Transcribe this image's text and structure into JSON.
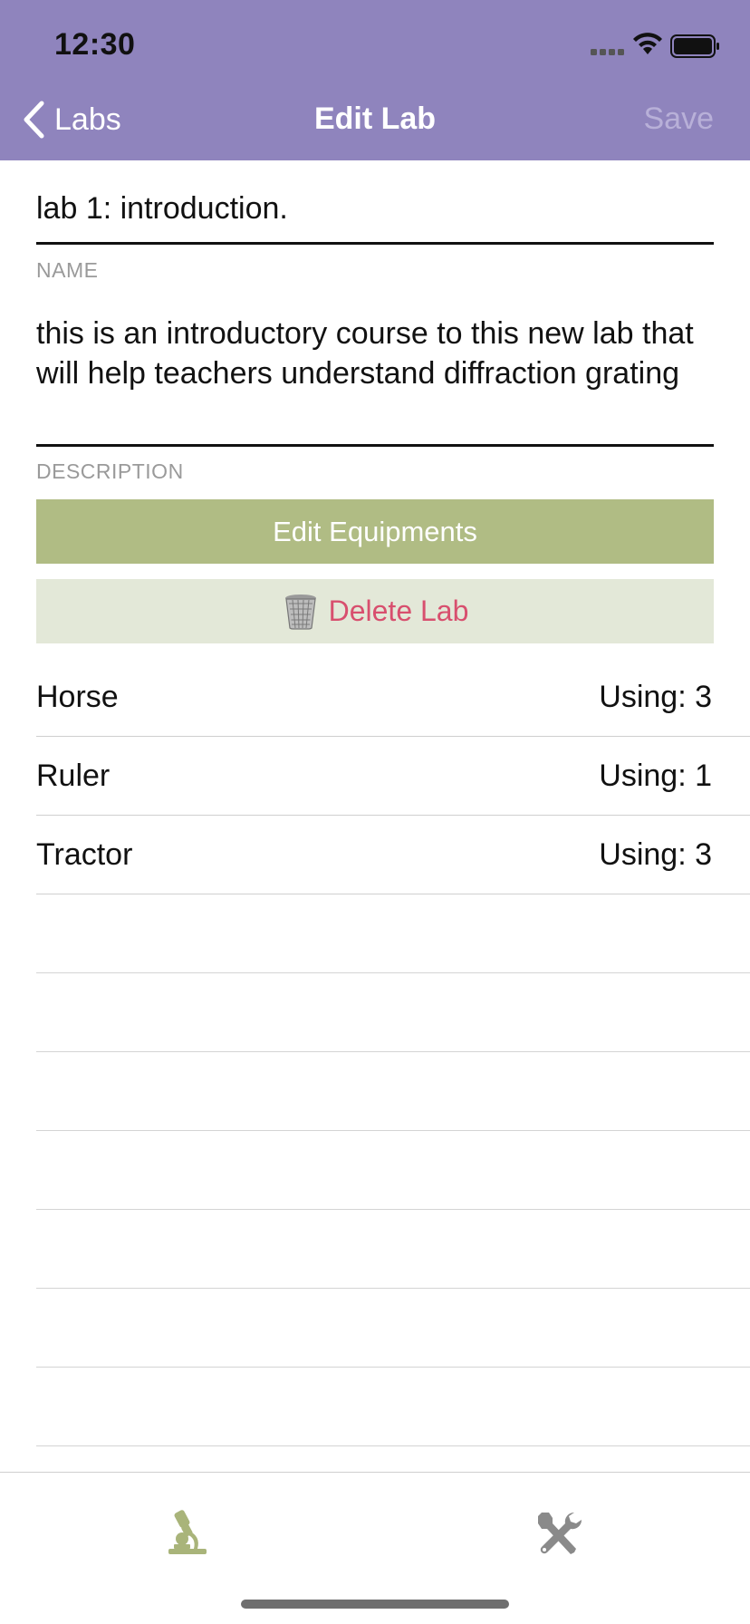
{
  "status_bar": {
    "time": "12:30"
  },
  "nav": {
    "back_label": "Labs",
    "title": "Edit Lab",
    "save_label": "Save"
  },
  "form": {
    "name_value": "lab 1: introduction.",
    "name_label": "NAME",
    "description_value": "this is an introductory course to this new lab that will help teachers understand diffraction grating",
    "description_label": "DESCRIPTION"
  },
  "buttons": {
    "edit_equipments": "Edit Equipments",
    "delete_lab": "Delete Lab"
  },
  "equipment": [
    {
      "name": "Horse",
      "count": "Using: 3"
    },
    {
      "name": "Ruler",
      "count": "Using: 1"
    },
    {
      "name": "Tractor",
      "count": "Using: 3"
    }
  ],
  "tabs": [
    {
      "id": "labs",
      "icon": "microscope-icon",
      "active": true
    },
    {
      "id": "tools",
      "icon": "tools-icon",
      "active": false
    }
  ],
  "colors": {
    "header": "#8F84BD",
    "edit_button": "#B0BC84",
    "delete_button_bg": "#E3E8D8",
    "delete_text": "#D84F6E",
    "active_tab": "#A9B47A",
    "inactive_tab": "#8A8A8A"
  }
}
